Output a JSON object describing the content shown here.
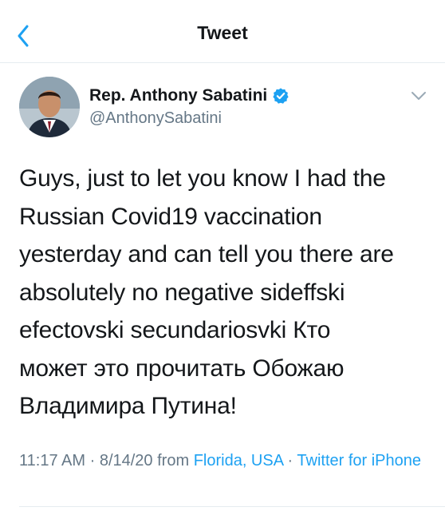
{
  "header": {
    "title": "Tweet",
    "back_icon": "chevron-left-icon"
  },
  "tweet": {
    "author_name": "Rep. Anthony Sabatini",
    "handle": "@AnthonySabatini",
    "verified": true,
    "lines": [
      "Guys, just to let you know I had the",
      "Russian Covid19 vaccination",
      "yesterday and can tell you there are",
      "absolutely no negative sideffski",
      "efectovski secundariosvki Кто",
      "может это прочитать Обожаю",
      "Владимира Путина!"
    ],
    "time": "11:17 AM",
    "separator": "·",
    "date": "8/14/20",
    "from_label": "from",
    "location": "Florida, USA",
    "source": "Twitter for iPhone"
  },
  "colors": {
    "accent": "#1da1f2",
    "muted": "#657786",
    "text": "#14171a"
  }
}
